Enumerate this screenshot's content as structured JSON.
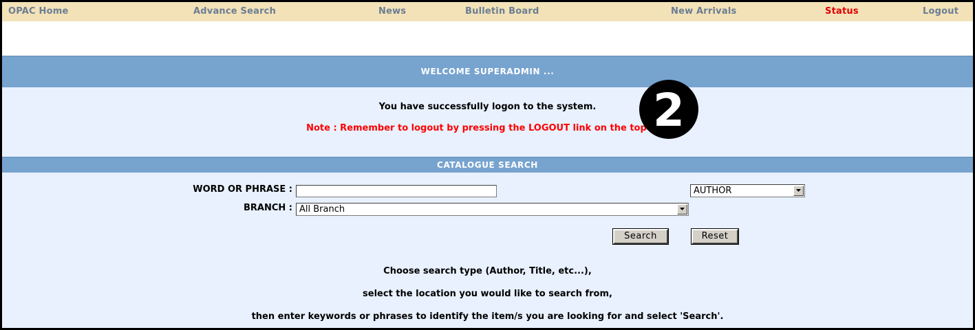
{
  "nav": {
    "items": [
      {
        "label": "OPAC Home"
      },
      {
        "label": "Advance Search"
      },
      {
        "label": "News"
      },
      {
        "label": "Bulletin Board"
      },
      {
        "label": "New Arrivals"
      },
      {
        "label": "Status"
      },
      {
        "label": "Logout"
      }
    ],
    "active_color": "#e00000"
  },
  "welcome": {
    "title": "WELCOME SUPERADMIN ...",
    "message": "You have successfully logon to the system.",
    "note": "Note : Remember to logout by pressing the LOGOUT link on the top bar."
  },
  "step_badge": {
    "number": "2",
    "icon": "step-number-badge"
  },
  "search": {
    "title": "CATALOGUE SEARCH",
    "word_label": "WORD OR PHRASE :",
    "word_value": "",
    "type_selected": "AUTHOR",
    "branch_label": "BRANCH :",
    "branch_selected": "All Branch",
    "search_button": "Search",
    "reset_button": "Reset",
    "help": [
      "Choose search type (Author, Title, etc...),",
      "select the location you would like to search from,",
      "then enter keywords or phrases to identify the item/s you are looking for and select 'Search'."
    ]
  },
  "colors": {
    "nav_bg": "#f3e2b8",
    "nav_link": "#6a7d93",
    "band_bg": "#77a3cf",
    "panel_bg": "#e8f1fd",
    "note": "#ff0000"
  }
}
